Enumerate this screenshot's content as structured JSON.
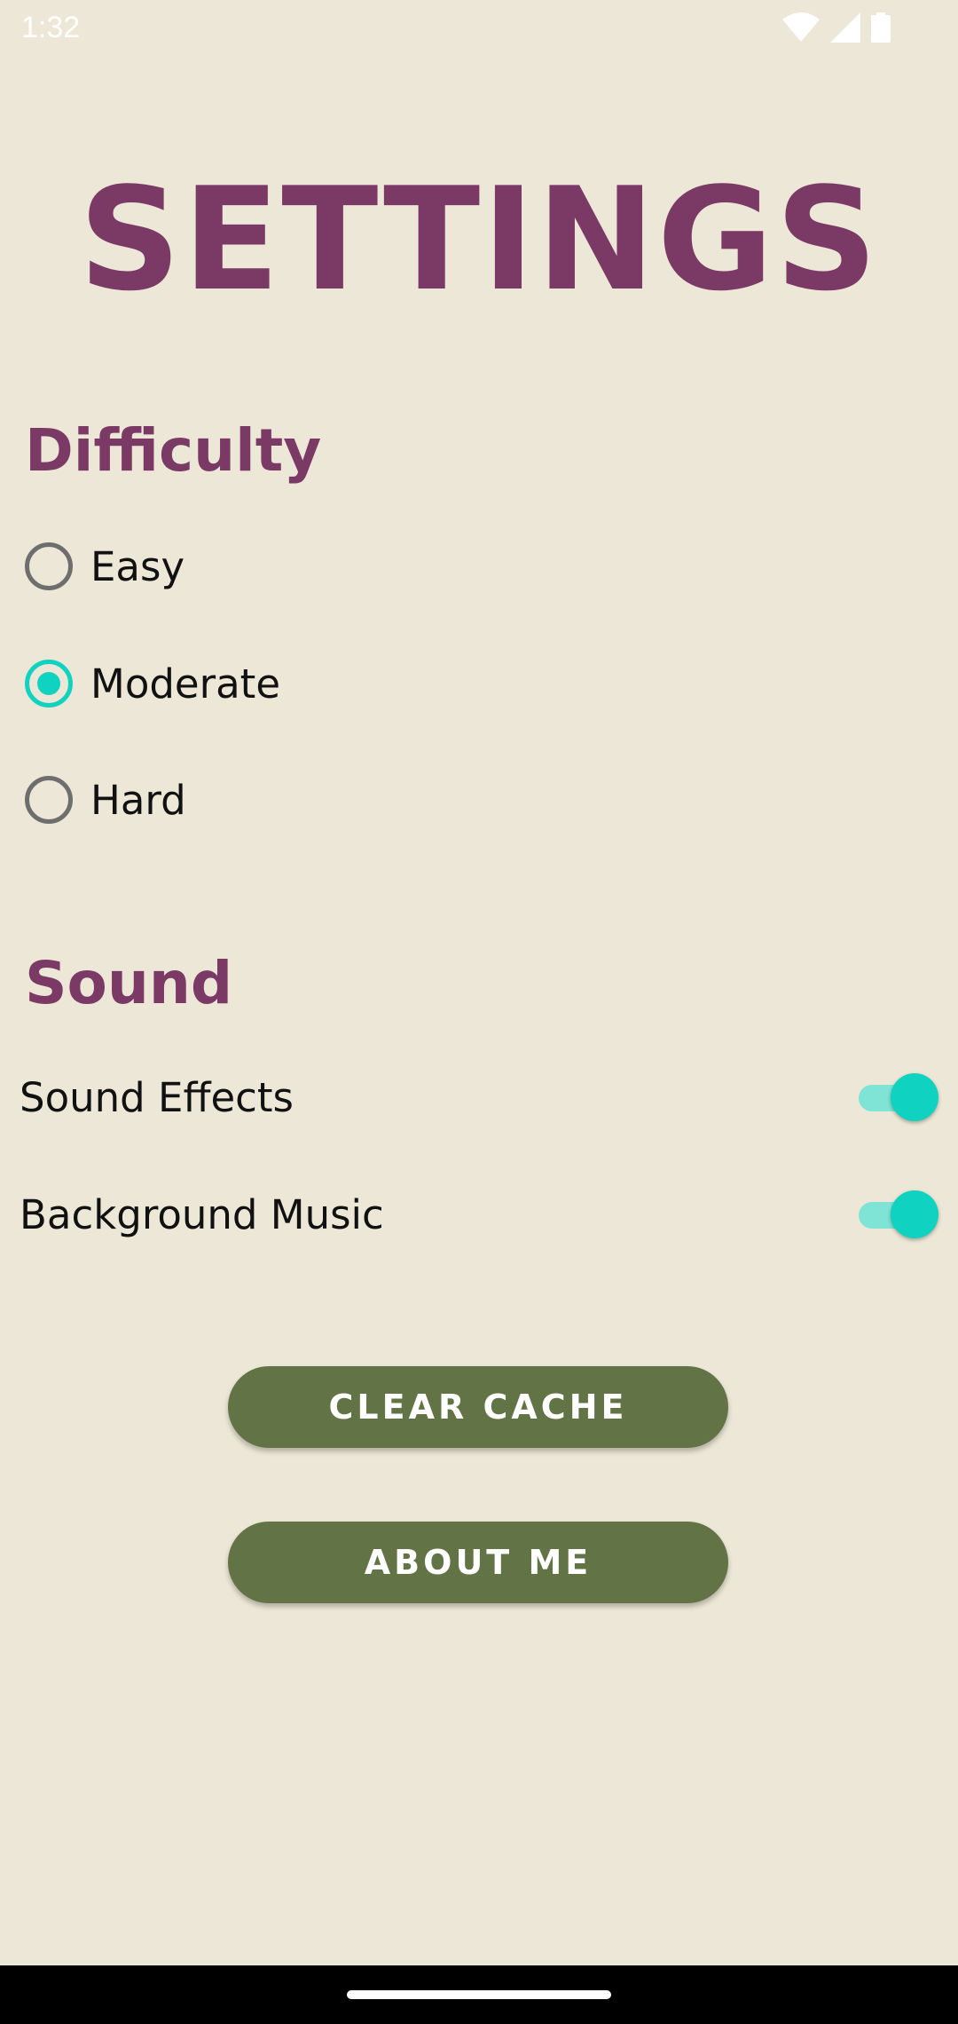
{
  "status_bar": {
    "time": "1:32",
    "icons": [
      "wifi-icon",
      "signal-icon",
      "battery-icon"
    ]
  },
  "title": "SETTINGS",
  "difficulty": {
    "heading": "Difficulty",
    "options": [
      {
        "label": "Easy",
        "selected": false
      },
      {
        "label": "Moderate",
        "selected": true
      },
      {
        "label": "Hard",
        "selected": false
      }
    ]
  },
  "sound": {
    "heading": "Sound",
    "toggles": [
      {
        "label": "Sound Effects",
        "on": true
      },
      {
        "label": "Background Music",
        "on": true
      }
    ]
  },
  "buttons": {
    "clear_cache": "CLEAR CACHE",
    "about_me": "ABOUT ME"
  },
  "colors": {
    "background": "#ECE7D6",
    "heading": "#7B3A66",
    "accent": "#0FD3C0",
    "button": "#627345"
  }
}
